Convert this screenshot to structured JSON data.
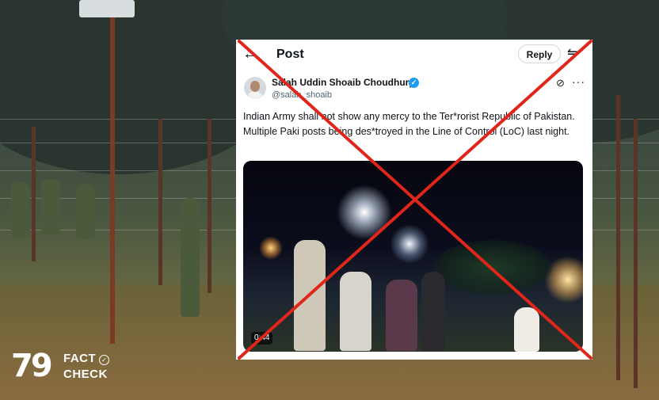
{
  "logo": {
    "digits": "79",
    "line1": "FACT",
    "line2": "CHECK"
  },
  "post": {
    "header_title": "Post",
    "reply_label": "Reply",
    "author_name": "Salah Uddin Shoaib Choudhury",
    "handle": "@salah_shoaib",
    "text": "Indian Army shall not show any mercy to the Ter*rorist Republic of Pakistan. Multiple Paki posts being des*troyed in the Line of Control (LoC) last night.",
    "video_timestamp": "0:44"
  },
  "icons": {
    "back": "back-arrow-icon",
    "tune": "tune-icon",
    "verified": "verified-badge-icon",
    "grok": "grok-icon",
    "more": "more-icon"
  },
  "colors": {
    "cross": "#e0251b",
    "verified": "#1d9bf0",
    "text": "#0f1419",
    "muted": "#536471"
  }
}
